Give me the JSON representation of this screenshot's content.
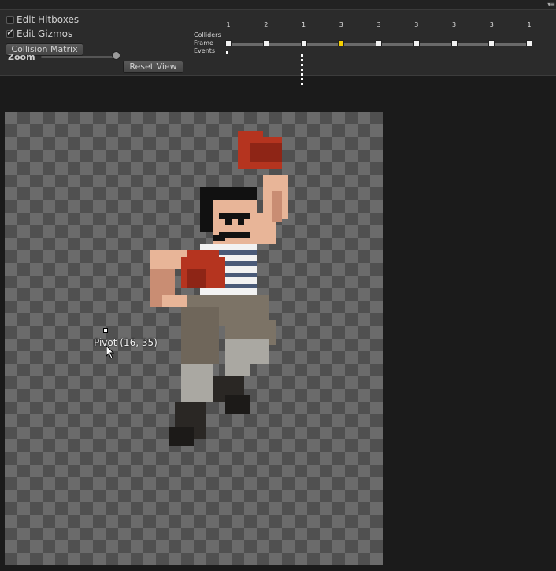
{
  "toolbar": {
    "edit_hitboxes_label": "Edit Hitboxes",
    "edit_hitboxes_checked": false,
    "edit_gizmos_label": "Edit Gizmos",
    "edit_gizmos_checked": true,
    "collision_matrix_label": "Collision Matrix",
    "zoom_label": "Zoom",
    "reset_view_label": "Reset View"
  },
  "timeline": {
    "row_labels": [
      "Colliders",
      "Frame",
      "Events"
    ],
    "frame_numbers": [
      "1",
      "2",
      "1",
      "3",
      "3",
      "3",
      "3",
      "3",
      "1"
    ],
    "selected_frame_index": 3,
    "current_frame_index": 2,
    "event_frame_index": 0
  },
  "canvas": {
    "pivot_label": "Pivot (16, 35)"
  },
  "colors": {
    "active_frame": "#f5d000",
    "panel_bg": "#2b2b2b",
    "checker_dark": "#505050",
    "checker_light": "#6b6b6b"
  },
  "icons": [
    "checkbox-icon",
    "checkmark-icon",
    "slider-thumb-icon",
    "mouse-pointer-icon",
    "tab-menu-icon"
  ]
}
